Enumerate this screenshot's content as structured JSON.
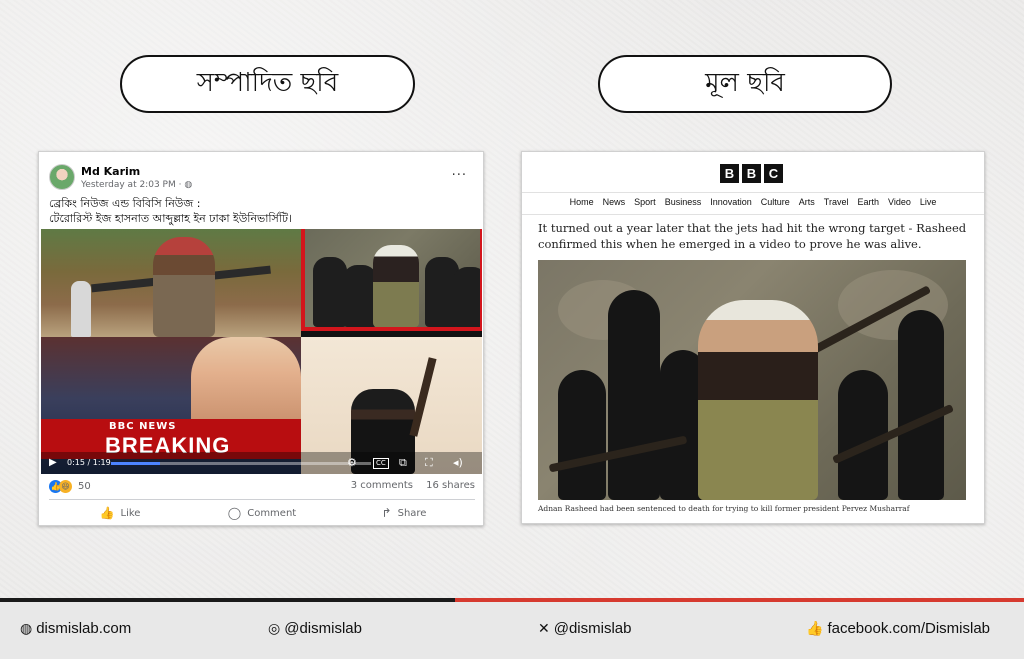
{
  "labels": {
    "edited": "সম্পাদিত ছবি",
    "original": "মূল ছবি"
  },
  "facebook_post": {
    "author": "Md Karim",
    "timestamp": "Yesterday at 2:03 PM · ",
    "globe_icon": "globe-icon",
    "more": "···",
    "caption_line1": "ব্রেকিং নিউজ এন্ড বিবিসি নিউজ :",
    "caption_line2": "টেরোরিস্ট ইজ হাসনাত আব্দুল্লাহ ইন ঢাকা ইউনিভার্সিটি।",
    "video": {
      "bbc_news": "BBC NEWS",
      "breaking": "BREAKING",
      "time": "0:15 / 1:19",
      "progress": 0.19,
      "cc": "CC"
    },
    "reaction_count": "50",
    "comments": "3 comments",
    "shares": "16 shares",
    "actions": [
      "Like",
      "Comment",
      "Share"
    ]
  },
  "bbc_article": {
    "logo_letters": [
      "B",
      "B",
      "C"
    ],
    "nav": [
      "Home",
      "News",
      "Sport",
      "Business",
      "Innovation",
      "Culture",
      "Arts",
      "Travel",
      "Earth",
      "Video",
      "Live"
    ],
    "body_text": "It turned out a year later that the jets had hit the wrong target - Rasheed confirmed this when he emerged in a video to prove he was alive.",
    "caption": "Adnan Rasheed had been sentenced to death for trying to kill former president Pervez Musharraf"
  },
  "footer": {
    "website": "dismislab.com",
    "instagram": "@dismislab",
    "x": "@dismislab",
    "facebook": "facebook.com/Dismislab"
  },
  "colors": {
    "accent_red": "#d63a2f",
    "frame_red": "#d3151c",
    "fb_blue": "#1877f2",
    "bbc_red": "#b80d10"
  }
}
